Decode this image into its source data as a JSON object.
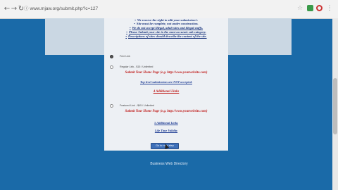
{
  "browser": {
    "url": "www.mjaw.org/submit.php?c=127",
    "back_icon": "←",
    "forward_icon": "→",
    "reload_icon": "↻",
    "lock_icon": "ⓘ",
    "star_icon": "☆",
    "menu_icon": "⋮"
  },
  "rules": [
    "We reserve the right to edit your submission's",
    "Site must be complete, not under construction.",
    "We do not accept Illegal, adult sites and illegal stuffs.",
    "Please Submit your site in the most accurate sub category.",
    "Descriptions of sites should describe the content of the site."
  ],
  "options": {
    "free": {
      "label": "Free Link"
    },
    "regular": {
      "label": "Regular Link - $15 / Unlimited",
      "submit_line": "Submit Your Home Page (e.g. http://www.yourwebsite.com)",
      "note": "Top level submissions are NOT accepted."
    },
    "extra_regular": {
      "additional": "4 Additional Links"
    },
    "featured": {
      "label": "Featured Link - $45 / Unlimited",
      "submit_line": "Submit Your Home Page (e.g. http://www.yourwebsite.com)",
      "additional": "5 Additional Links",
      "validity": "Life Time Validity"
    }
  },
  "submit_button": "Go to next step",
  "footer": "Business Web Directory"
}
